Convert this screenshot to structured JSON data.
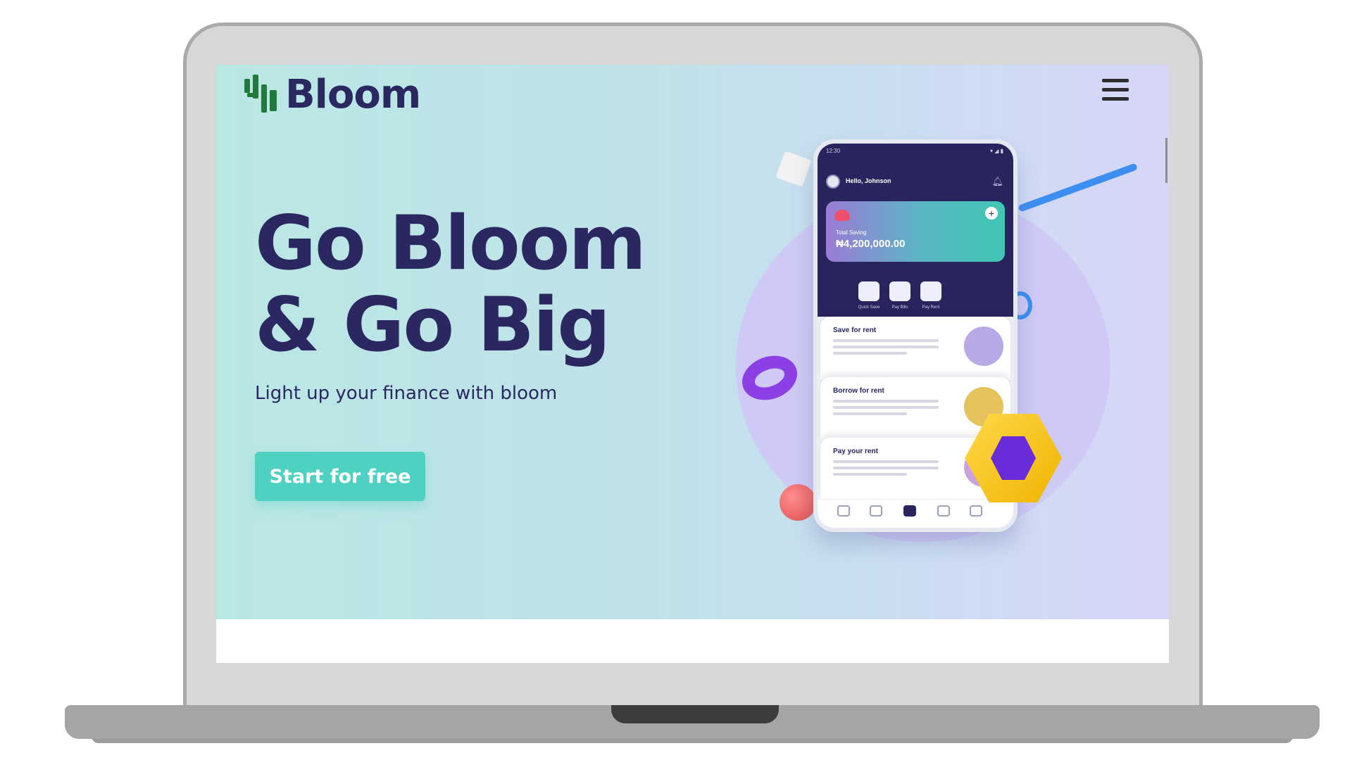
{
  "header": {
    "brand_name": "Bloom",
    "logo_icon": "bloom-logo-icon",
    "menu_icon": "hamburger-menu-icon"
  },
  "hero": {
    "headline_line1": "Go Bloom",
    "headline_line2": "& Go Big",
    "subheadline": "Light up your finance with bloom",
    "cta_label": "Start for free"
  },
  "phone": {
    "greeting": "Hello, Johnson",
    "card_label": "Total Saving",
    "card_amount": "₦4,200,000.00",
    "quick_actions": [
      "Quick Save",
      "Pay Bills",
      "Pay Rent"
    ],
    "rent_cards": [
      {
        "title": "Save for rent"
      },
      {
        "title": "Borrow for rent"
      },
      {
        "title": "Pay your rent"
      }
    ]
  },
  "colors": {
    "brand_navy": "#2a2761",
    "cta_teal": "#4fd1c1",
    "logo_green": "#1f7a3c"
  }
}
